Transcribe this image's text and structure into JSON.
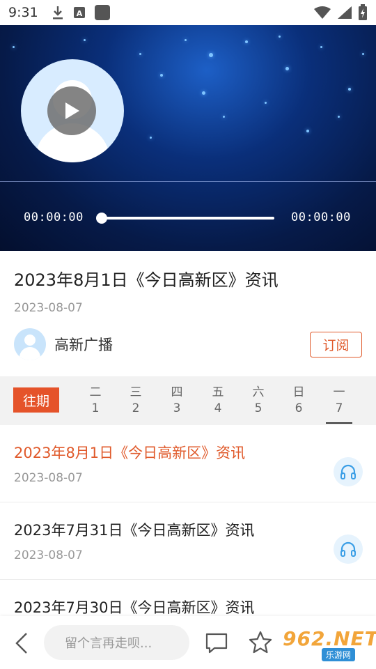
{
  "status_bar": {
    "time": "9:31"
  },
  "player": {
    "current_time": "00:00:00",
    "total_time": "00:00:00",
    "progress": 0
  },
  "article": {
    "title": "2023年8月1日《今日高新区》资讯",
    "date": "2023-08-07",
    "author": "高新广播",
    "subscribe_label": "订阅"
  },
  "week": {
    "past_label": "往期",
    "days": [
      {
        "weekday": "二",
        "num": "1"
      },
      {
        "weekday": "三",
        "num": "2"
      },
      {
        "weekday": "四",
        "num": "3"
      },
      {
        "weekday": "五",
        "num": "4"
      },
      {
        "weekday": "六",
        "num": "5"
      },
      {
        "weekday": "日",
        "num": "6"
      },
      {
        "weekday": "一",
        "num": "7"
      }
    ]
  },
  "list": {
    "items": [
      {
        "title": "2023年8月1日《今日高新区》资讯",
        "date": "2023-08-07"
      },
      {
        "title": "2023年7月31日《今日高新区》资讯",
        "date": "2023-08-07"
      },
      {
        "title": "2023年7月30日《今日高新区》资讯",
        "date": ""
      }
    ]
  },
  "bottom_bar": {
    "comment_placeholder": "留个言再走呗..."
  },
  "watermark": {
    "top": "962.NET",
    "bottom": "乐游网"
  },
  "colors": {
    "accent": "#e05a2b",
    "listen_icon": "#3a9ee6"
  },
  "icons": [
    "download-icon",
    "font-a-icon",
    "app-square-icon",
    "wifi-icon",
    "signal-icon",
    "battery-icon",
    "play-icon",
    "headphones-icon",
    "back-arrow-icon",
    "comment-icon",
    "star-icon"
  ]
}
